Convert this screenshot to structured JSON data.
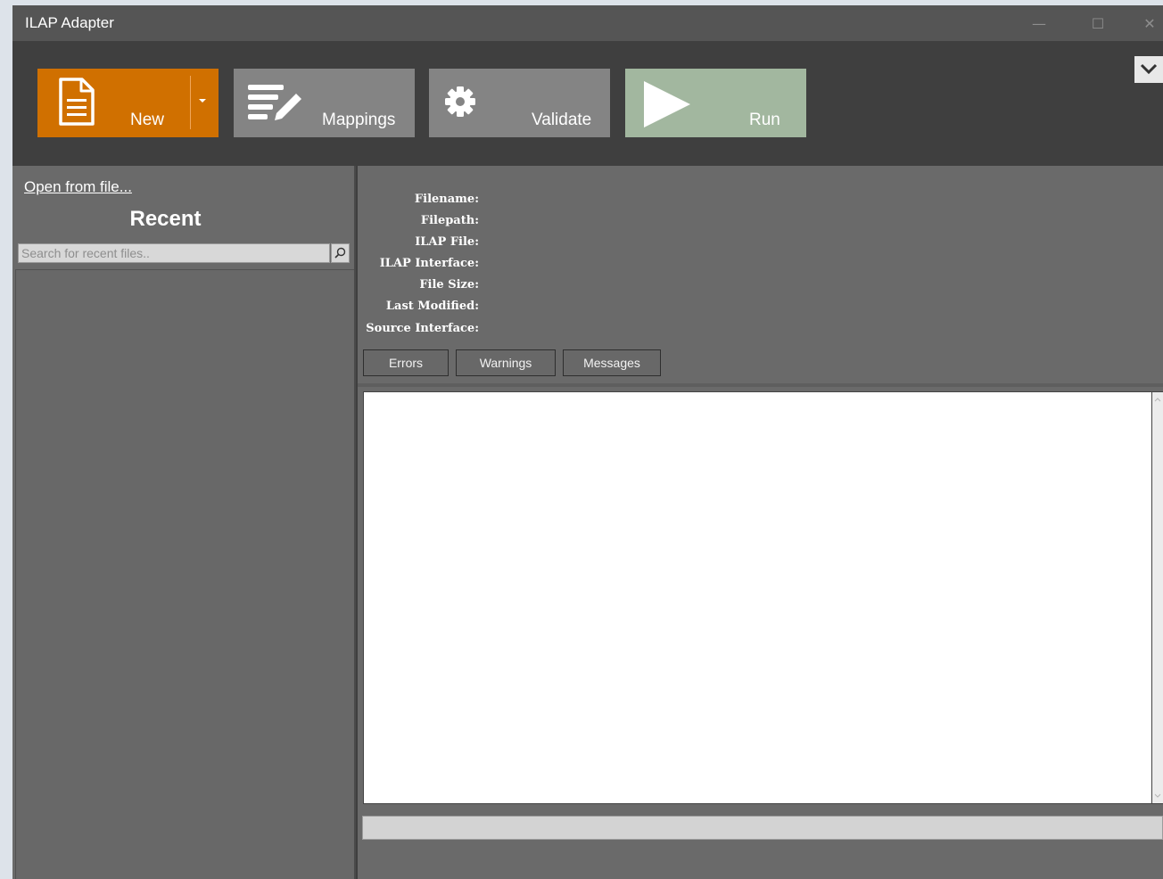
{
  "window": {
    "title": "ILAP Adapter",
    "controls": {
      "minimize": "—",
      "maximize": "☐",
      "close": "✕"
    }
  },
  "ribbon": {
    "new_label": "New",
    "mappings_label": "Mappings",
    "validate_label": "Validate",
    "run_label": "Run",
    "colors": {
      "new": "#d07000",
      "mappings": "#848484",
      "validate": "#848484",
      "run": "#a2b79f"
    }
  },
  "left": {
    "open_link": "Open from file...",
    "recent_title": "Recent",
    "search_placeholder": "Search for recent files.."
  },
  "info": {
    "filename": "Filename:",
    "filepath": "Filepath:",
    "ilap_file": "ILAP File:",
    "ilap_interface": "ILAP Interface:",
    "file_size": "File Size:",
    "last_modified": "Last Modified:",
    "source_interface": "Source Interface:"
  },
  "tabs": {
    "errors": "Errors",
    "warnings": "Warnings",
    "messages": "Messages"
  },
  "icons": {
    "new": "document-icon",
    "mappings": "edit-list-icon",
    "validate": "gear-icon",
    "run": "play-icon",
    "search": "search-icon",
    "collapse": "chevron-down-icon"
  }
}
